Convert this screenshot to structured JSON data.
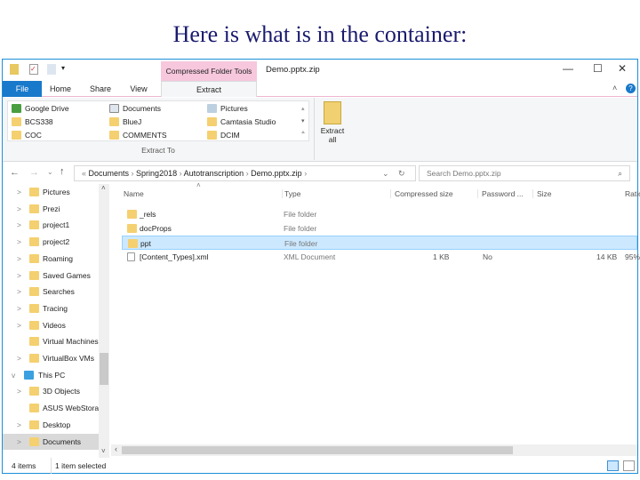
{
  "slide_title": "Here is what is in the container:",
  "window": {
    "title": "Demo.pptx.zip",
    "context_tab": "Compressed Folder Tools"
  },
  "tabs": [
    "File",
    "Home",
    "Share",
    "View",
    "Extract"
  ],
  "ribbon": {
    "destinations": [
      "Google Drive",
      "Documents",
      "Pictures",
      "BCS338",
      "BlueJ",
      "Camtasia Studio",
      "COC",
      "COMMENTS",
      "DCIM"
    ],
    "group_label": "Extract To",
    "extract_all": "Extract all"
  },
  "address": {
    "path": [
      "Documents",
      "Spring2018",
      "Autotranscription",
      "Demo.pptx.zip"
    ],
    "search_placeholder": "Search Demo.pptx.zip"
  },
  "nav": [
    {
      "label": "Pictures",
      "chev": ">"
    },
    {
      "label": "Prezi",
      "chev": ">"
    },
    {
      "label": "project1",
      "chev": ">"
    },
    {
      "label": "project2",
      "chev": ">"
    },
    {
      "label": "Roaming",
      "chev": ">"
    },
    {
      "label": "Saved Games",
      "chev": ">"
    },
    {
      "label": "Searches",
      "chev": ">"
    },
    {
      "label": "Tracing",
      "chev": ">"
    },
    {
      "label": "Videos",
      "chev": ">"
    },
    {
      "label": "Virtual Machines",
      "chev": ""
    },
    {
      "label": "VirtualBox VMs",
      "chev": ">"
    },
    {
      "label": "This PC",
      "chev": "v"
    },
    {
      "label": "3D Objects",
      "chev": ">"
    },
    {
      "label": "ASUS WebStorage",
      "chev": ""
    },
    {
      "label": "Desktop",
      "chev": ">"
    },
    {
      "label": "Documents",
      "chev": ">"
    }
  ],
  "columns": [
    "Name",
    "Type",
    "Compressed size",
    "Password ...",
    "Size",
    "Ratio"
  ],
  "files": [
    {
      "name": "_rels",
      "type": "File folder",
      "csize": "",
      "pw": "",
      "size": "",
      "ratio": ""
    },
    {
      "name": "docProps",
      "type": "File folder",
      "csize": "",
      "pw": "",
      "size": "",
      "ratio": ""
    },
    {
      "name": "ppt",
      "type": "File folder",
      "csize": "",
      "pw": "",
      "size": "",
      "ratio": ""
    },
    {
      "name": "[Content_Types].xml",
      "type": "XML Document",
      "csize": "1 KB",
      "pw": "No",
      "size": "14 KB",
      "ratio": "95%"
    }
  ],
  "status": {
    "count": "4 items",
    "selected": "1 item selected"
  }
}
